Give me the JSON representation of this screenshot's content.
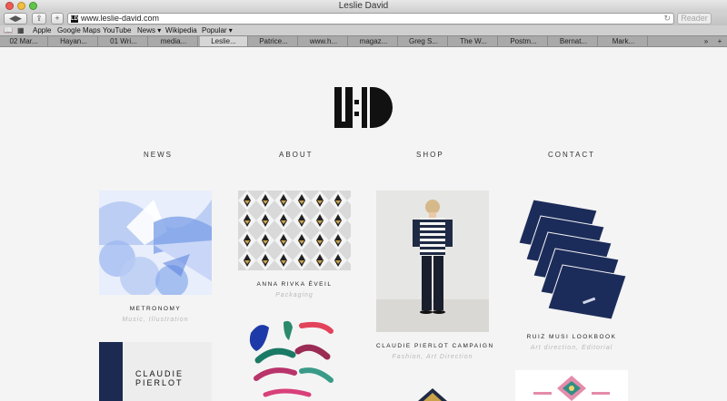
{
  "window": {
    "title": "Leslie David"
  },
  "toolbar": {
    "add_label": "+",
    "url": "www.leslie-david.com",
    "reader_label": "Reader"
  },
  "bookmarks": [
    "Apple",
    "Google Maps",
    "YouTube",
    "News ▾",
    "Wikipedia",
    "Popular ▾"
  ],
  "tabs": [
    "02 Mar...",
    "Hayan...",
    "01 Wri...",
    "media...",
    "Leslie...",
    "Patrice...",
    "www.h...",
    "magaz...",
    "Greg S...",
    "The W...",
    "Postm...",
    "Bernat...",
    "Mark..."
  ],
  "active_tab_index": 4,
  "nav": [
    "NEWS",
    "ABOUT",
    "SHOP",
    "CONTACT"
  ],
  "projects": [
    {
      "title": "METRONOMY",
      "subtitle": "Music, Illustration"
    },
    {
      "title": "ANNA RIVKA ÉVEIL",
      "subtitle": "Packaging"
    },
    {
      "title": "CLAUDIE PIERLOT CAMPAIGN",
      "subtitle": "Fashion, Art Direction"
    },
    {
      "title": "RUIZ MUSI LOOKBOOK",
      "subtitle": "Art direction, Editorial"
    }
  ],
  "claudie_book": {
    "line1": "CLAUDIE",
    "line2": "PIERLOT"
  }
}
